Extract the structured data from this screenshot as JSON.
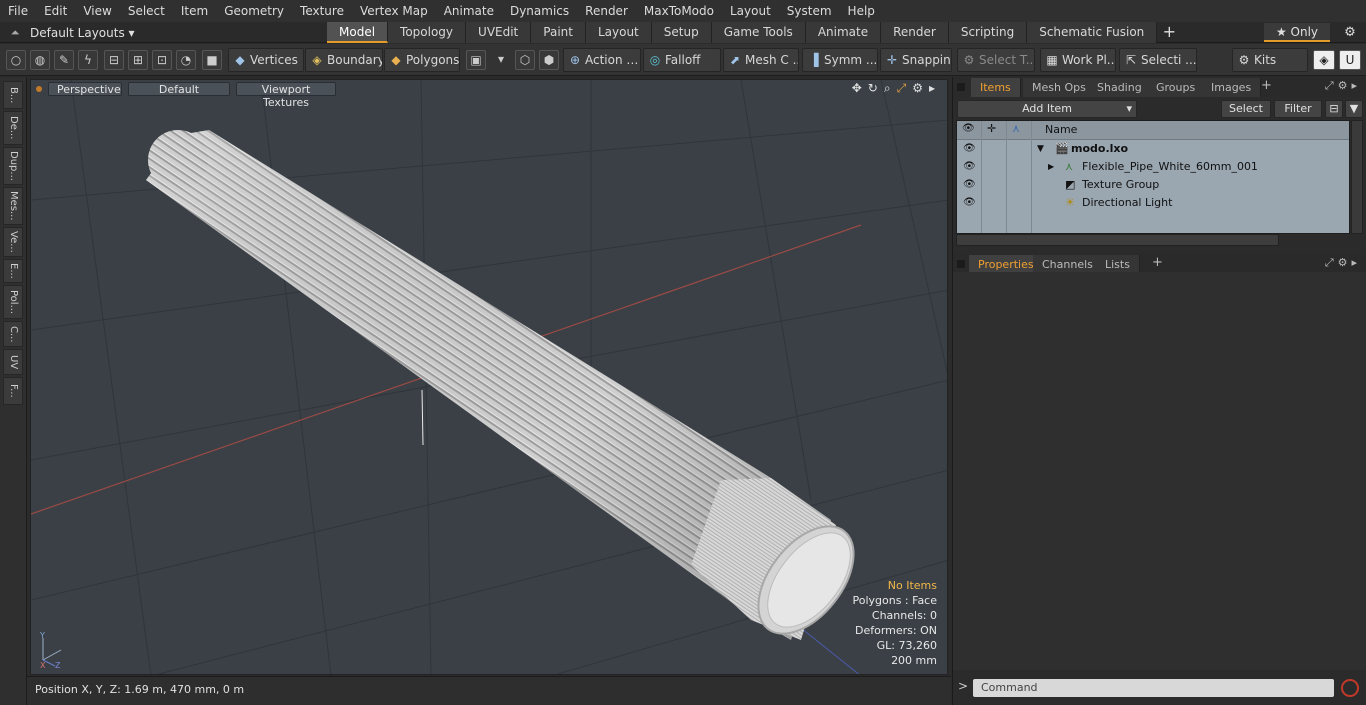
{
  "menu": [
    "File",
    "Edit",
    "View",
    "Select",
    "Item",
    "Geometry",
    "Texture",
    "Vertex Map",
    "Animate",
    "Dynamics",
    "Render",
    "MaxToModo",
    "Layout",
    "System",
    "Help"
  ],
  "layouts": {
    "label": "Default Layouts ▾"
  },
  "mode_tabs": [
    {
      "label": "Model",
      "active": true
    },
    {
      "label": "Topology"
    },
    {
      "label": "UVEdit"
    },
    {
      "label": "Paint"
    },
    {
      "label": "Layout"
    },
    {
      "label": "Setup"
    },
    {
      "label": "Game Tools"
    },
    {
      "label": "Animate"
    },
    {
      "label": "Render"
    },
    {
      "label": "Scripting"
    },
    {
      "label": "Schematic Fusion"
    }
  ],
  "only_label": "★ Only",
  "toolbar": {
    "vertices": "Vertices",
    "boundary": "Boundary",
    "polygons": "Polygons",
    "action": "Action",
    "falloff": "Falloff",
    "mesh": "Mesh C ...",
    "symm": "Symm ...",
    "snapping": "Snapping",
    "select_t": "Select T...",
    "work_pl": "Work Pl...",
    "selecti": "Selecti ...",
    "kits": "Kits"
  },
  "left_tabs": [
    "B...",
    "De...",
    "Dup...",
    "Mes...",
    "Ve...",
    "E...",
    "Pol...",
    "C...",
    "UV",
    "F..."
  ],
  "viewport": {
    "perspective": "Perspective",
    "default": "Default",
    "textures": "Viewport Textures",
    "info": {
      "no_items": "No Items",
      "polygons": "Polygons : Face",
      "channels": "Channels: 0",
      "deformers": "Deformers: ON",
      "gl": "GL: 73,260",
      "scale": "200 mm"
    }
  },
  "status": {
    "position": "Position X, Y, Z:   1.69 m, 470 mm, 0 m"
  },
  "items_panel": {
    "tabs": [
      {
        "label": "Items",
        "active": true
      },
      {
        "label": "Mesh Ops"
      },
      {
        "label": "Shading"
      },
      {
        "label": "Groups"
      },
      {
        "label": "Images"
      }
    ],
    "add_item": "Add Item",
    "select": "Select",
    "filter": "Filter",
    "col_name": "Name",
    "rows": [
      {
        "label": "modo.lxo"
      },
      {
        "label": "Flexible_Pipe_White_60mm_001"
      },
      {
        "label": "Texture Group"
      },
      {
        "label": "Directional Light"
      }
    ]
  },
  "props_panel": {
    "tabs": [
      {
        "label": "Properties",
        "active": true
      },
      {
        "label": "Channels"
      },
      {
        "label": "Lists"
      }
    ]
  },
  "command": {
    "placeholder": "Command"
  }
}
